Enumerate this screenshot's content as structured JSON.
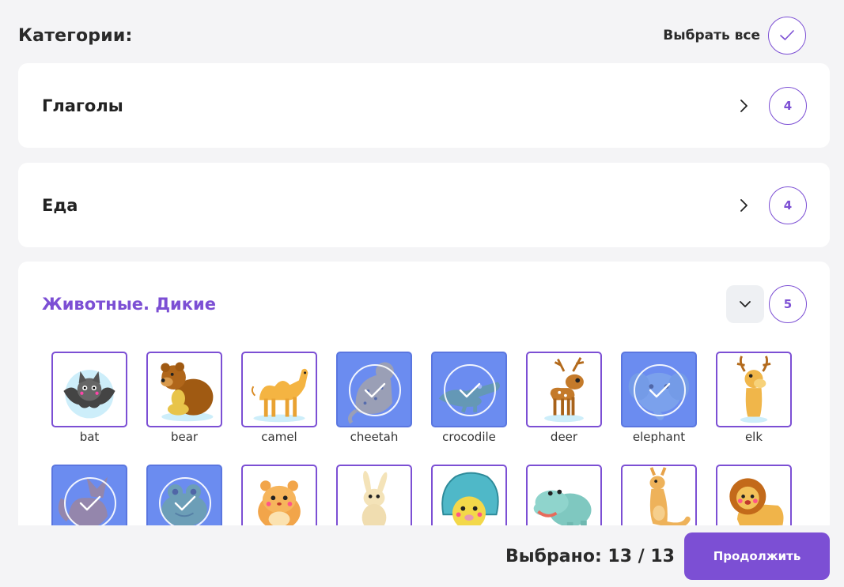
{
  "header": {
    "title": "Категории:",
    "select_all_label": "Выбрать все"
  },
  "categories": [
    {
      "name": "Глаголы",
      "count": "4",
      "expanded": false
    },
    {
      "name": "Еда",
      "count": "4",
      "expanded": false
    },
    {
      "name": "Животные. Дикие",
      "count": "5",
      "expanded": true
    }
  ],
  "items": [
    {
      "label": "bat",
      "icon": "bat-icon",
      "selected": false
    },
    {
      "label": "bear",
      "icon": "bear-icon",
      "selected": false
    },
    {
      "label": "camel",
      "icon": "camel-icon",
      "selected": false
    },
    {
      "label": "cheetah",
      "icon": "cheetah-icon",
      "selected": true
    },
    {
      "label": "crocodile",
      "icon": "crocodile-icon",
      "selected": true
    },
    {
      "label": "deer",
      "icon": "deer-icon",
      "selected": false
    },
    {
      "label": "elephant",
      "icon": "elephant-icon",
      "selected": true
    },
    {
      "label": "elk",
      "icon": "elk-icon",
      "selected": false
    },
    {
      "label": "",
      "icon": "fox-icon",
      "selected": true
    },
    {
      "label": "",
      "icon": "frog-icon",
      "selected": true
    },
    {
      "label": "",
      "icon": "hamster-icon",
      "selected": false
    },
    {
      "label": "",
      "icon": "hare-icon",
      "selected": false
    },
    {
      "label": "",
      "icon": "hedgehog-icon",
      "selected": false
    },
    {
      "label": "",
      "icon": "hippo-icon",
      "selected": false
    },
    {
      "label": "",
      "icon": "kangaroo-icon",
      "selected": false
    },
    {
      "label": "",
      "icon": "lion-icon",
      "selected": false
    }
  ],
  "footer": {
    "selected_text": "Выбрано: 13 / 13",
    "continue_label": "Продолжить"
  },
  "colors": {
    "accent": "#7c4fd4",
    "selected_tile": "#6b8cf0",
    "background": "#f4f4f6"
  }
}
